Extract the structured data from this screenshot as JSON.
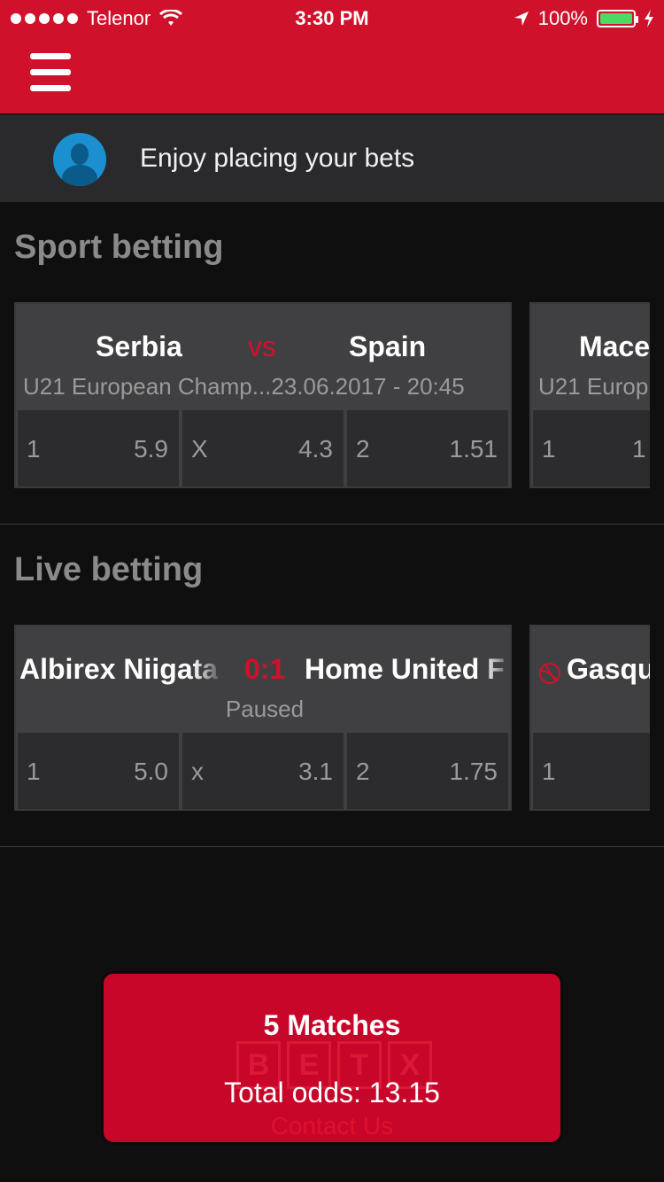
{
  "status_bar": {
    "carrier": "Telenor",
    "time": "3:30 PM",
    "battery": "100%"
  },
  "welcome": {
    "text": "Enjoy placing your bets"
  },
  "sport_betting": {
    "title": "Sport betting",
    "cards": [
      {
        "home": "Serbia",
        "vs": "vs",
        "away": "Spain",
        "subtitle": "U21 European Champ...23.06.2017 - 20:45",
        "odds": [
          {
            "label": "1",
            "value": "5.9"
          },
          {
            "label": "X",
            "value": "4.3"
          },
          {
            "label": "2",
            "value": "1.51"
          }
        ]
      },
      {
        "home": "Mace",
        "subtitle": "U21 Europ",
        "odds": [
          {
            "label": "1",
            "value": "1"
          }
        ]
      }
    ]
  },
  "live_betting": {
    "title": "Live betting",
    "cards": [
      {
        "home": "Albirex Niigata",
        "score": "0:1",
        "away": "Home United F",
        "subtitle": "Paused",
        "odds": [
          {
            "label": "1",
            "value": "5.0"
          },
          {
            "label": "x",
            "value": "3.1"
          },
          {
            "label": "2",
            "value": "1.75"
          }
        ]
      },
      {
        "home": "Gasqu",
        "odds": [
          {
            "label": "1",
            "value": ""
          }
        ]
      }
    ]
  },
  "bet_slip": {
    "matches": "5 Matches",
    "total": "Total odds: 13.15",
    "watermark_letters": [
      "B",
      "E",
      "T",
      "X"
    ],
    "contact": "Contact Us"
  }
}
